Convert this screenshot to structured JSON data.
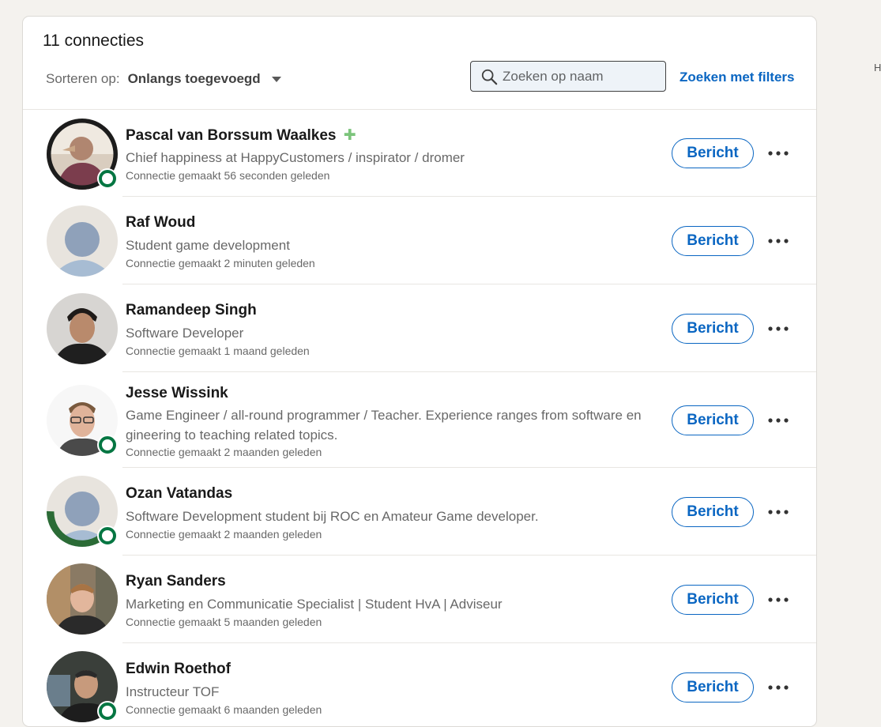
{
  "header": {
    "count_label": "11 connecties",
    "sort_label": "Sorteren op:",
    "sort_value": "Onlangs toegevoegd",
    "search_placeholder": "Zoeken op naam",
    "filter_link": "Zoeken met filters"
  },
  "edge_text": "H",
  "colors": {
    "accent": "#0a66c2",
    "online": "#057642",
    "open_to_work": "#2b6b36"
  },
  "connections": [
    {
      "name": "Pascal van Borssum Waalkes",
      "badge": "puzzle-icon",
      "headline": "Chief happiness at HappyCustomers / inspirator / dromer",
      "time": "Connectie gemaakt 56 seconden geleden",
      "message": "Bericht",
      "online": true,
      "avatar_ring_text": "#OpenToConnect"
    },
    {
      "name": "Raf Woud",
      "headline": "Student game development",
      "time": "Connectie gemaakt 2 minuten geleden",
      "message": "Bericht",
      "online": false
    },
    {
      "name": "Ramandeep Singh",
      "headline": "Software Developer",
      "time": "Connectie gemaakt 1 maand geleden",
      "message": "Bericht",
      "online": false
    },
    {
      "name": "Jesse Wissink",
      "headline": "Game Engineer / all-round programmer / Teacher. Experience ranges from software en gineering to teaching related topics.",
      "time": "Connectie gemaakt 2 maanden geleden",
      "message": "Bericht",
      "online": true
    },
    {
      "name": "Ozan Vatandas",
      "headline": "Software Development student bij ROC en Amateur Game developer.",
      "time": "Connectie gemaakt 2 maanden geleden",
      "message": "Bericht",
      "online": true,
      "avatar_ring_text": "#OPENTOWORK"
    },
    {
      "name": "Ryan Sanders",
      "headline": "Marketing en Communicatie Specialist | Student HvA | Adviseur",
      "time": "Connectie gemaakt 5 maanden geleden",
      "message": "Bericht",
      "online": false
    },
    {
      "name": "Edwin Roethof",
      "headline": "Instructeur TOF",
      "time": "Connectie gemaakt 6 maanden geleden",
      "message": "Bericht",
      "online": true
    }
  ]
}
